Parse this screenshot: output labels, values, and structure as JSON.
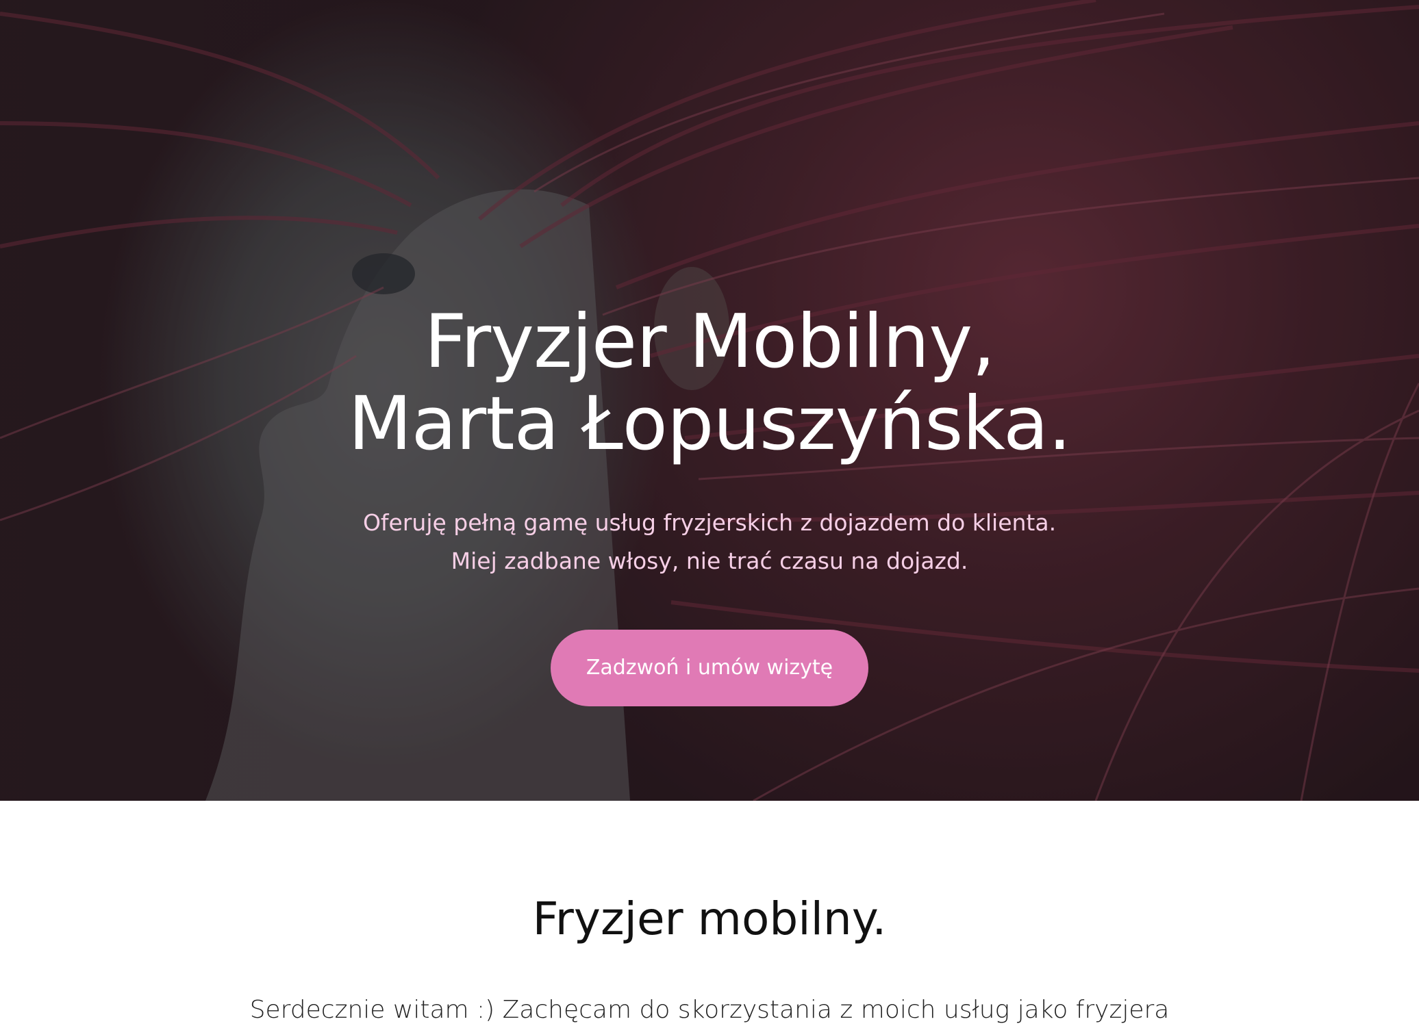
{
  "hero": {
    "title_line1": "Fryzjer Mobilny,",
    "title_line2": "Marta Łopuszyńska.",
    "subtitle_line1": "Oferuję pełną gamę usług fryzjerskich z dojazdem do klienta.",
    "subtitle_line2": "Miej zadbane włosy, nie trać czasu na dojazd.",
    "cta_label": "Zadzwoń i umów wizytę"
  },
  "intro": {
    "title": "Fryzjer mobilny.",
    "text": "Serdecznie witam :) Zachęcam do skorzystania z moich usług jako fryzjera"
  },
  "colors": {
    "accent": "#e07ab5",
    "subtitle": "#f6cfe6"
  }
}
